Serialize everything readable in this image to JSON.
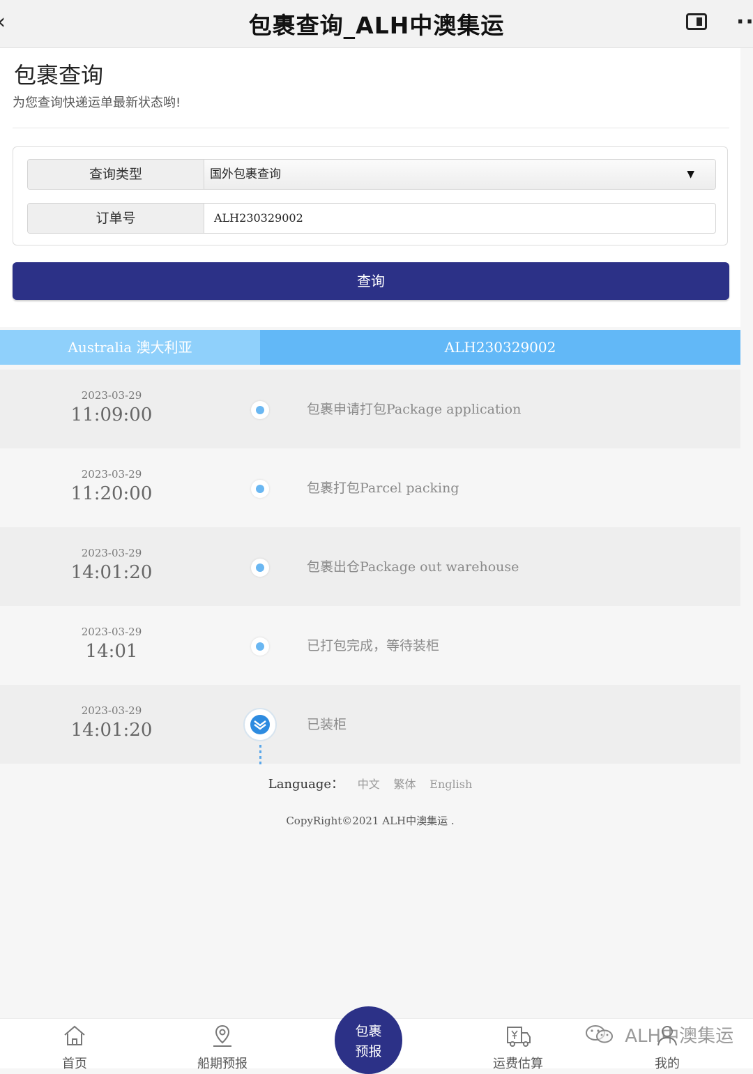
{
  "window": {
    "title": "包裹查询_ALH中澳集运",
    "back_glyph": "‹",
    "more_glyph": "··"
  },
  "header": {
    "title": "包裹查询",
    "subtitle": "为您查询快递运单最新状态哟!"
  },
  "form": {
    "type_label": "查询类型",
    "type_value": "国外包裹查询",
    "order_label": "订单号",
    "order_value": "ALH230329002"
  },
  "query_button": "查询",
  "tracking": {
    "country": "Australia 澳大利亚",
    "tracking_no": "ALH230329002",
    "events": [
      {
        "date": "2023-03-29",
        "time": "11:09:00",
        "text": "包裹申请打包Package application"
      },
      {
        "date": "2023-03-29",
        "time": "11:20:00",
        "text": "包裹打包Parcel packing"
      },
      {
        "date": "2023-03-29",
        "time": "14:01:20",
        "text": "包裹出仓Package out warehouse"
      },
      {
        "date": "2023-03-29",
        "time": "14:01",
        "text": "已打包完成，等待装柜"
      },
      {
        "date": "2023-03-29",
        "time": "14:01:20",
        "text": "已装柜"
      }
    ]
  },
  "footer": {
    "language_label": "Language：",
    "languages": [
      "中文",
      "繁体",
      "English"
    ],
    "copyright": "CopyRight©2021 ALH中澳集运 ."
  },
  "tabbar": {
    "home": "首页",
    "schedule": "船期预报",
    "center_line1": "包裹",
    "center_line2": "预报",
    "freight": "运费估算",
    "mine": "我的"
  },
  "watermark": "ALH中澳集运",
  "colors": {
    "primary": "#2c3187",
    "tab_left": "#8fd0fb",
    "tab_right": "#62b8f7",
    "dot": "#6ab7f2"
  }
}
